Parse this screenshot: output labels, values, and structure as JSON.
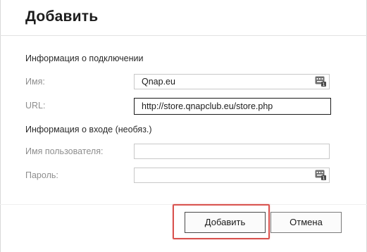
{
  "dialog": {
    "title": "Добавить"
  },
  "connection": {
    "section_title": "Информация о подключении",
    "name_label": "Имя:",
    "name_value": "Qnap.eu",
    "url_label": "URL:",
    "url_value": "http://store.qnapclub.eu/store.php"
  },
  "login": {
    "section_title": "Информация о входе (необяз.)",
    "username_label": "Имя пользователя:",
    "username_value": "",
    "password_label": "Пароль:",
    "password_value": ""
  },
  "buttons": {
    "add_label": "Добавить",
    "cancel_label": "Отмена"
  },
  "icons": {
    "name_field_icon": "keyboard-icon",
    "password_field_icon": "keyboard-icon"
  },
  "colors": {
    "highlight": "#d9534f"
  }
}
